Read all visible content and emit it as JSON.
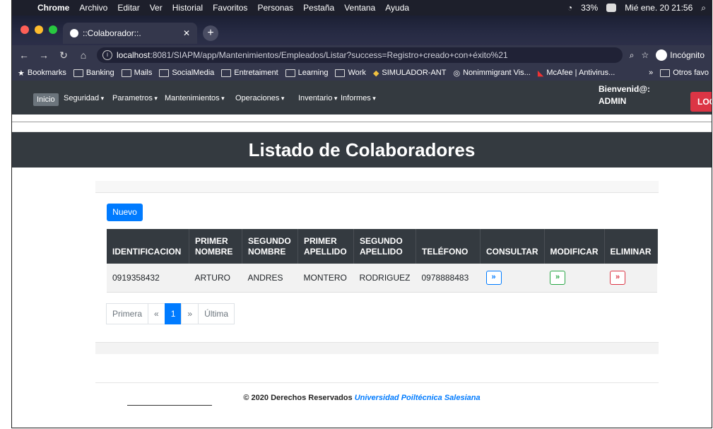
{
  "macos": {
    "app": "Chrome",
    "menus": [
      "Archivo",
      "Editar",
      "Ver",
      "Historial",
      "Favoritos",
      "Personas",
      "Pestaña",
      "Ventana",
      "Ayuda"
    ],
    "battery": "33%",
    "clock": "Mié ene. 20  21:56"
  },
  "browser": {
    "tab_title": "::Colaborador::.",
    "url_host": "localhost",
    "url_rest": ":8081/SIAPM/app/Mantenimientos/Empleados/Listar?success=Registro+creado+con+éxito%21",
    "profile": "Incógnito",
    "bookmarks": [
      "Bookmarks",
      "Banking",
      "Mails",
      "SocialMedia",
      "Entretaiment",
      "Learning",
      "Work",
      "SIMULADOR-ANT",
      "Nonimmigrant Vis...",
      "McAfee | Antivirus..."
    ],
    "more_bookmarks": "»",
    "other_favs": "Otros favo"
  },
  "nav": {
    "home": "Inicio",
    "items": [
      "Seguridad",
      "Parametros",
      "Mantenimientos",
      "Operaciones",
      "Inventario",
      "Informes"
    ],
    "welcome_line1": "Bienvenid@:",
    "welcome_user": "ADMIN",
    "logout": "LOG"
  },
  "page": {
    "title": "Listado de Colaboradores",
    "new_button": "Nuevo"
  },
  "table": {
    "headers": [
      "IDENTIFICACION",
      "PRIMER\nNOMBRE",
      "SEGUNDO\nNOMBRE",
      "PRIMER\nAPELLIDO",
      "SEGUNDO\nAPELLIDO",
      "TELÉFONO",
      "CONSULTAR",
      "MODIFICAR",
      "ELIMINAR"
    ],
    "rows": [
      {
        "id": "0919358432",
        "nombre1": "ARTURO",
        "nombre2": "ANDRES",
        "apellido1": "MONTERO",
        "apellido2": "RODRIGUEZ",
        "telefono": "0978888483",
        "btn": "»"
      }
    ]
  },
  "pagination": {
    "first": "Primera",
    "prev": "«",
    "current": "1",
    "next": "»",
    "last": "Última"
  },
  "footer": {
    "text": "© 2020 Derechos Reservados",
    "university": "Universidad Poiltécnica Salesiana"
  },
  "colors": {
    "dark": "#343a40",
    "primary": "#007bff",
    "success": "#28a745",
    "danger": "#dc3545"
  }
}
